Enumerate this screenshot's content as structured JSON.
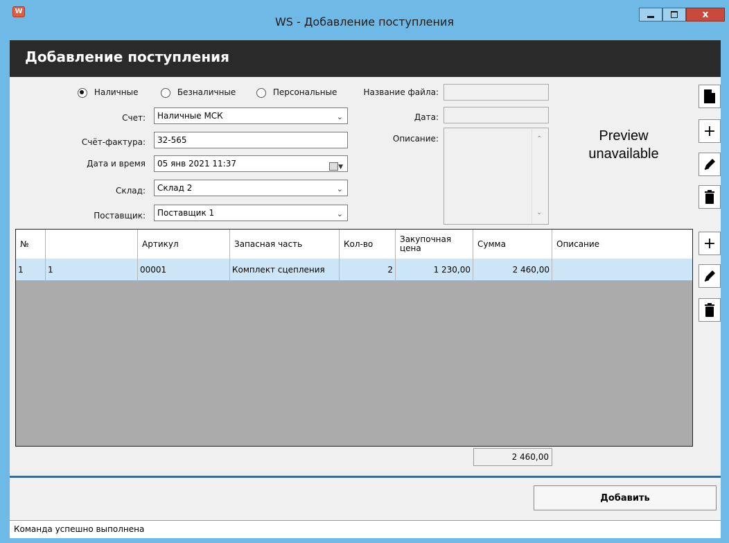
{
  "window": {
    "title": "WS - Добавление поступления",
    "icon_label": "W",
    "minimize": "▁",
    "maximize": "▢",
    "close": "x"
  },
  "header": {
    "title": "Добавление поступления"
  },
  "payment": {
    "options": [
      {
        "label": "Наличные",
        "selected": true
      },
      {
        "label": "Безналичные",
        "selected": false
      },
      {
        "label": "Персональные",
        "selected": false
      }
    ]
  },
  "form": {
    "account_label": "Счет:",
    "account_value": "Наличные МСК",
    "invoice_label": "Счёт-фактура:",
    "invoice_value": "32-565",
    "datetime_label": "Дата и время",
    "datetime_value": "05 янв  2021 11:37",
    "warehouse_label": "Склад:",
    "warehouse_value": "Склад 2",
    "supplier_label": "Поставщик:",
    "supplier_value": "Поставщик 1"
  },
  "file": {
    "name_label": "Название файла:",
    "name_value": "",
    "date_label": "Дата:",
    "date_value": "",
    "desc_label": "Описание:",
    "desc_value": ""
  },
  "preview": {
    "text_line1": "Preview",
    "text_line2": "unavailable"
  },
  "table": {
    "columns": [
      "№",
      "",
      "Артикул",
      "Запасная часть",
      "Кол-во",
      "Закупочная цена",
      "Сумма",
      "Описание"
    ],
    "rows": [
      [
        "1",
        "1",
        "00001",
        "Комплект сцепления",
        "2",
        "1 230,00",
        "2 460,00",
        ""
      ]
    ],
    "total": "2 460,00"
  },
  "footer": {
    "add_button": "Добавить"
  },
  "status": {
    "text": "Команда успешно выполнена"
  }
}
